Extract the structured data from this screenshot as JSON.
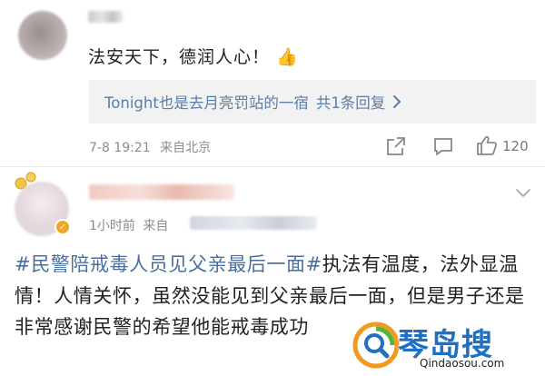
{
  "comment": {
    "text": "法安天下，德润人心！",
    "emoji": "👍",
    "reply_preview": "Tonight也是去月亮罚站的一宿",
    "reply_count_label": "共1条回复",
    "date": "7-8 19:21",
    "location": "来自北京",
    "like_count": "120"
  },
  "post": {
    "time": "1小时前",
    "source_prefix": "来自",
    "hashtag": "#民警陪戒毒人员见父亲最后一面#",
    "body": "执法有温度，法外显温情！人情关怀，虽然没能见到父亲最后一面，但是男子还是非常感谢民警的",
    "body_tail": "希望他能戒毒成功"
  },
  "watermark": {
    "brand": "琴岛搜",
    "url": "Qindaosou.com"
  },
  "colors": {
    "link_blue": "#5a7ea8",
    "hashtag_blue": "#4a6f9e",
    "meta_gray": "#8c8c8c",
    "reply_bg": "#f2f2f2",
    "badge_orange": "#f2a623"
  }
}
